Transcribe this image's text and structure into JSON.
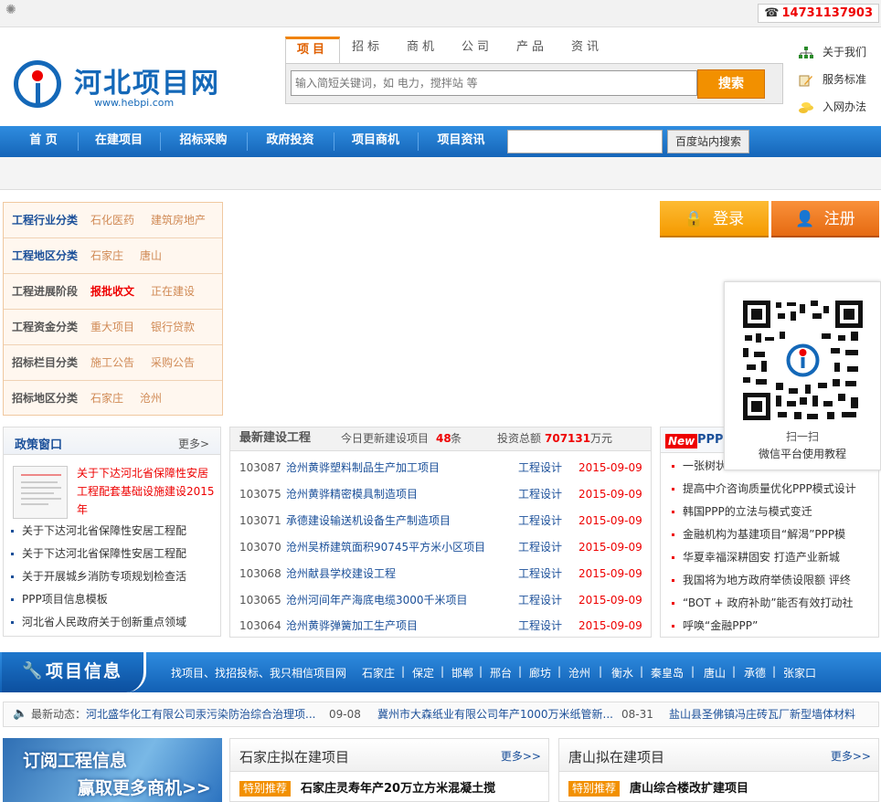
{
  "topbar": {
    "phone": "14731137903"
  },
  "header": {
    "logo_title": "河北项目网",
    "logo_url": "www.hebpi.com",
    "search_tabs": [
      "项目",
      "招标",
      "商机",
      "公司",
      "产品",
      "资讯"
    ],
    "search_placeholder": "输入简短关键词，如 电力，搅拌站 等",
    "search_button": "搜索",
    "right_links": [
      "关于我们",
      "服务标准",
      "入网办法"
    ]
  },
  "nav": {
    "items": [
      "首 页",
      "在建项目",
      "招标采购",
      "政府投资",
      "项目商机",
      "项目资讯"
    ],
    "site_search_button": "百度站内搜索"
  },
  "categories": [
    {
      "label": "工程行业分类",
      "values": [
        "石化医药",
        "建筑房地产"
      ]
    },
    {
      "label": "工程地区分类",
      "values": [
        "石家庄",
        "唐山"
      ]
    },
    {
      "label": "工程进展阶段",
      "values": [
        "报批收文",
        "正在建设"
      ]
    },
    {
      "label": "工程资金分类",
      "values": [
        "重大项目",
        "银行贷款"
      ]
    },
    {
      "label": "招标栏目分类",
      "values": [
        "施工公告",
        "采购公告"
      ]
    },
    {
      "label": "招标地区分类",
      "values": [
        "石家庄",
        "沧州"
      ]
    }
  ],
  "auth": {
    "login": "登录",
    "register": "注册"
  },
  "qr": {
    "line1": "扫一扫",
    "line2": "微信平台使用教程"
  },
  "policy": {
    "title": "政策窗口",
    "more": "更多>",
    "feature": "关于下达河北省保障性安居工程配套基础设施建设2015年",
    "items": [
      "关于下达河北省保障性安居工程配",
      "关于下达河北省保障性安居工程配",
      "关于开展城乡消防专项规划检查活",
      "PPP项目信息模板",
      "河北省人民政府关于创新重点领域"
    ]
  },
  "projects": {
    "title": "最新建设工程",
    "today_label": "今日更新建设项目",
    "today_count": "48",
    "today_unit": "条",
    "invest_label": "投资总额",
    "invest_value": "707131",
    "invest_unit": "万元",
    "rows": [
      {
        "id": "103087",
        "name": "沧州黄骅塑料制品生产加工项目",
        "status": "工程设计",
        "date": "2015-09-09"
      },
      {
        "id": "103075",
        "name": "沧州黄骅精密模具制造项目",
        "status": "工程设计",
        "date": "2015-09-09"
      },
      {
        "id": "103071",
        "name": "承德建设输送机设备生产制造项目",
        "status": "工程设计",
        "date": "2015-09-09"
      },
      {
        "id": "103070",
        "name": "沧州吴桥建筑面积90745平方米小区项目",
        "status": "工程设计",
        "date": "2015-09-09"
      },
      {
        "id": "103068",
        "name": "沧州献县学校建设工程",
        "status": "工程设计",
        "date": "2015-09-09"
      },
      {
        "id": "103065",
        "name": "沧州河间年产海底电缆3000千米项目",
        "status": "工程设计",
        "date": "2015-09-09"
      },
      {
        "id": "103064",
        "name": "沧州黄骅弹簧加工生产项目",
        "status": "工程设计",
        "date": "2015-09-09"
      }
    ]
  },
  "ppp": {
    "badge": "New",
    "title": "PPP",
    "items": [
      "一张树状",
      "提高中介咨询质量优化PPP模式设计",
      "韩国PPP的立法与模式变迁",
      "金融机构为基建项目“解渴”PPP模",
      "华夏幸福深耕固安  打造产业新城",
      "我国将为地方政府举债设限额 评终",
      "“BOT + 政府补助”能否有效打动社",
      "呼唤“金融PPP”"
    ]
  },
  "infobar": {
    "title": "项目信息",
    "slogan": "找项目、找招投标、我只相信项目网",
    "cities": [
      "石家庄",
      "保定",
      "邯郸",
      "邢台",
      "廊坊",
      "沧州",
      "衡水",
      "秦皇岛",
      "唐山",
      "承德",
      "张家口"
    ]
  },
  "ticker": {
    "label": "最新动态：",
    "items": [
      {
        "text": "河北盛华化工有限公司汞污染防治综合治理项...",
        "date": "09-08"
      },
      {
        "text": "冀州市大森纸业有限公司年产1000万米纸管新...",
        "date": "08-31"
      },
      {
        "text": "盐山县圣佛镇冯庄砖瓦厂新型墙体材料",
        "date": ""
      }
    ]
  },
  "subscribe": {
    "line1": "订阅工程信息",
    "line2": "赢取更多商机>>"
  },
  "bottom_boxes": [
    {
      "title": "石家庄拟在建项目",
      "more": "更多>>",
      "tag": "特别推荐",
      "item": "石家庄灵寿年产20万立方米混凝土搅"
    },
    {
      "title": "唐山拟在建项目",
      "more": "更多>>",
      "tag": "特别推荐",
      "item": "唐山综合楼改扩建项目"
    }
  ]
}
